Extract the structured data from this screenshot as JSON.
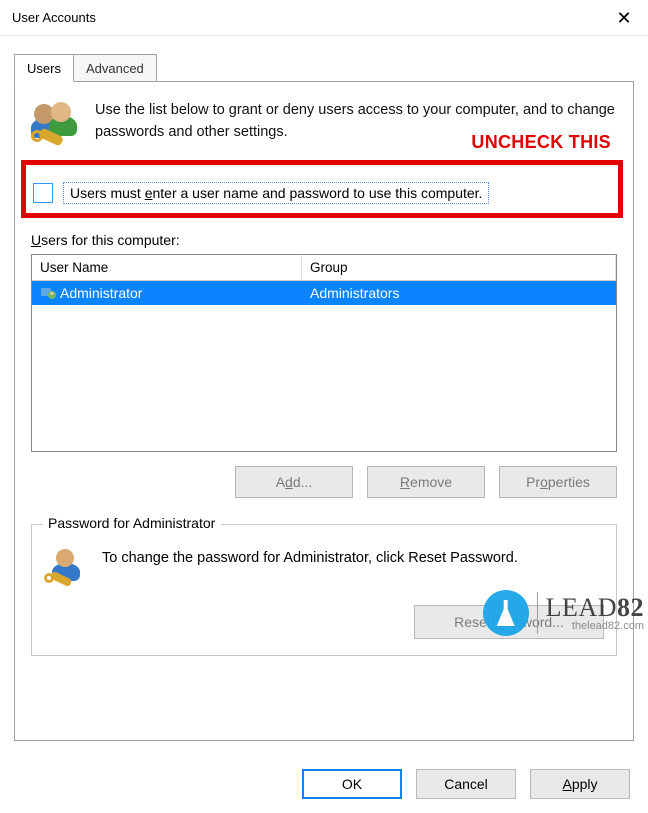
{
  "window": {
    "title": "User Accounts",
    "close_glyph": "✕"
  },
  "tabs": {
    "users": "Users",
    "advanced": "Advanced"
  },
  "intro": "Use the list below to grant or deny users access to your computer, and to change passwords and other settings.",
  "annotation": "UNCHECK THIS",
  "checkbox": {
    "label_pre": "Users must ",
    "label_key": "e",
    "label_post": "nter a user name and password to use this computer."
  },
  "users_section": {
    "label_pre": "",
    "label_key": "U",
    "label_post": "sers for this computer:",
    "columns": {
      "username": "User Name",
      "group": "Group"
    },
    "rows": [
      {
        "username": "Administrator",
        "group": "Administrators"
      }
    ]
  },
  "buttons": {
    "add_pre": "A",
    "add_key": "d",
    "add_post": "d...",
    "remove_pre": "",
    "remove_key": "R",
    "remove_post": "emove",
    "properties_pre": "Pr",
    "properties_key": "o",
    "properties_post": "perties"
  },
  "password_box": {
    "legend": "Password for Administrator",
    "text": "To change the password for Administrator, click Reset Password.",
    "reset_pre": "Reset ",
    "reset_key": "P",
    "reset_post": "assword..."
  },
  "footer": {
    "ok": "OK",
    "cancel": "Cancel",
    "apply_pre": "",
    "apply_key": "A",
    "apply_post": "pply"
  },
  "watermark": {
    "brand_left": "LEAD",
    "brand_right": "82",
    "sub": "thelead82.com"
  }
}
